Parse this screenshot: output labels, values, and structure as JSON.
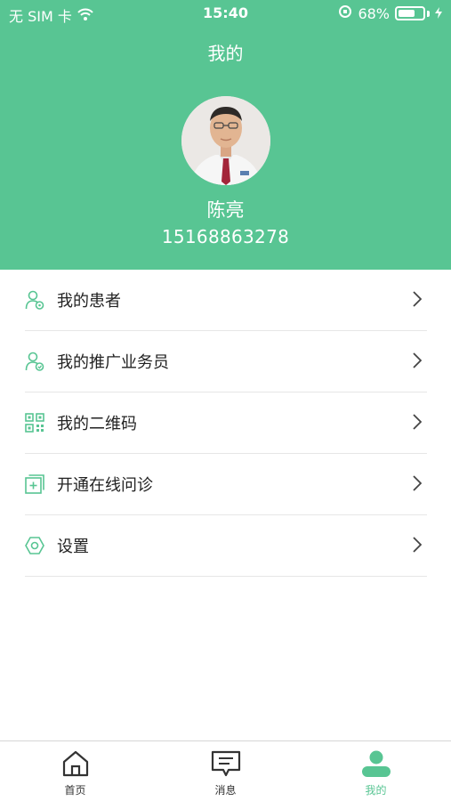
{
  "statusbar": {
    "carrier": "无 SIM 卡",
    "time": "15:40",
    "battery_text": "68%",
    "battery_level": 0.68
  },
  "header": {
    "title": "我的"
  },
  "profile": {
    "name": "陈亮",
    "phone": "15168863278"
  },
  "menu": [
    {
      "label": "我的患者",
      "icon": "patient-icon"
    },
    {
      "label": "我的推广业务员",
      "icon": "salesman-icon"
    },
    {
      "label": "我的二维码",
      "icon": "qrcode-icon"
    },
    {
      "label": "开通在线问诊",
      "icon": "online-consult-icon"
    },
    {
      "label": "设置",
      "icon": "settings-icon"
    }
  ],
  "tabs": [
    {
      "label": "首页",
      "icon": "home-icon"
    },
    {
      "label": "消息",
      "icon": "message-icon"
    },
    {
      "label": "我的",
      "icon": "profile-icon",
      "active": true
    }
  ],
  "colors": {
    "accent": "#58c593",
    "text": "#222222",
    "divider": "#e6e6e6"
  }
}
